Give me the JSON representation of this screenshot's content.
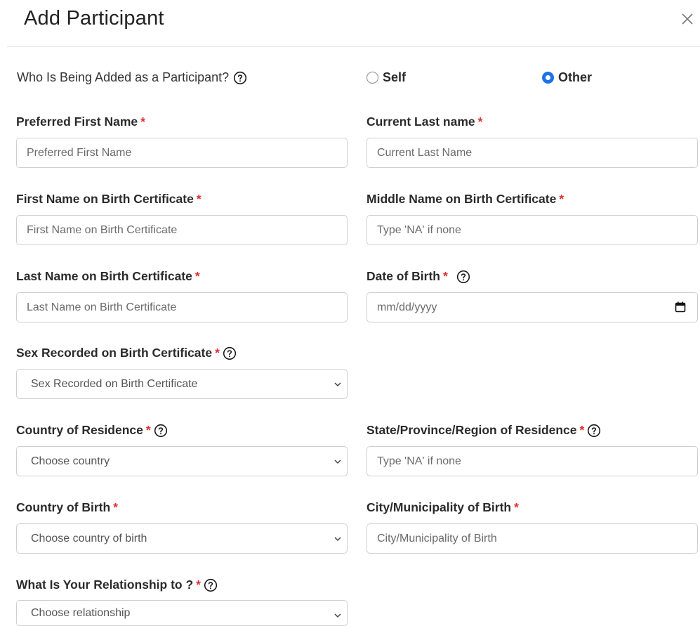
{
  "header": {
    "title": "Add Participant",
    "close_icon": "close-icon"
  },
  "who": {
    "question": "Who Is Being Added as a Participant?",
    "options": [
      {
        "label": "Self",
        "selected": false
      },
      {
        "label": "Other",
        "selected": true
      }
    ]
  },
  "required_marker": "*",
  "fields": {
    "preferred_first": {
      "label": "Preferred First Name",
      "placeholder": "Preferred First Name"
    },
    "current_last": {
      "label": "Current Last name",
      "placeholder": "Current Last Name"
    },
    "first_birth": {
      "label": "First Name on Birth Certificate",
      "placeholder": "First Name on Birth Certificate"
    },
    "middle_birth": {
      "label": "Middle Name on Birth Certificate",
      "placeholder": "Type 'NA' if none"
    },
    "last_birth": {
      "label": "Last Name on Birth Certificate",
      "placeholder": "Last Name on Birth Certificate"
    },
    "dob": {
      "label": "Date of Birth",
      "placeholder": "mm/dd/yyyy"
    },
    "sex": {
      "label": "Sex Recorded on Birth Certificate",
      "value": "Sex Recorded on Birth Certificate"
    },
    "country_res": {
      "label": "Country of Residence",
      "value": "Choose country"
    },
    "state_res": {
      "label": "State/Province/Region of Residence",
      "placeholder": "Type 'NA' if none"
    },
    "country_birth": {
      "label": "Country of Birth",
      "value": "Choose country of birth"
    },
    "city_birth": {
      "label": "City/Municipality of Birth",
      "placeholder": "City/Municipality of Birth"
    },
    "relationship": {
      "label": "What Is Your Relationship to ?",
      "value": "Choose relationship"
    }
  },
  "colors": {
    "accent": "#1a73e8",
    "required": "#e03030",
    "border": "#cfcfcf"
  }
}
